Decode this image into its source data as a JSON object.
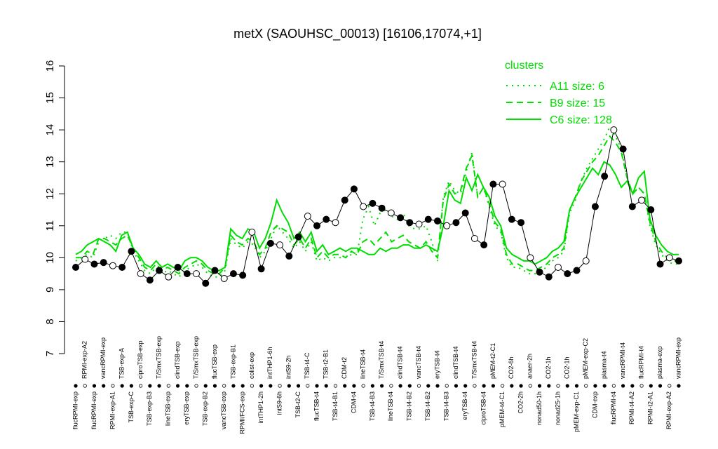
{
  "chart_data": {
    "type": "line",
    "title": "metX (SAOUHSC_00013) [16106,17074,+1]",
    "xlabel": "",
    "ylabel": "",
    "ylim": [
      7,
      16
    ],
    "yticks": [
      7,
      8,
      9,
      10,
      11,
      12,
      13,
      14,
      15,
      16
    ],
    "series": [
      {
        "name": "C6 size: 128",
        "style": "solid",
        "values": [
          10.1,
          10.2,
          10.4,
          10.5,
          10.6,
          10.5,
          10.4,
          10.2,
          10.7,
          10.8,
          10.3,
          10.1,
          9.8,
          9.7,
          9.9,
          9.7,
          9.8,
          9.7,
          9.6,
          9.9,
          10.0,
          10.0,
          9.9,
          9.7,
          9.6,
          9.6,
          9.7,
          10.9,
          10.7,
          10.6,
          10.9,
          10.8,
          10.3,
          10.6,
          11.1,
          11.8,
          11.4,
          11.1,
          10.6,
          10.8,
          10.5,
          10.8,
          10.2,
          10.4,
          10.1,
          10.2,
          10.3,
          10.2,
          10.3,
          10.3,
          10.2,
          10.1,
          10.1,
          10.3,
          10.2,
          10.3,
          10.3,
          10.4,
          10.4,
          10.3,
          10.3,
          10.4,
          10.3,
          10.2,
          11.0,
          12.1,
          11.8,
          11.7,
          12.5,
          12.1,
          12.6,
          12.2,
          11.9,
          11.3,
          11.0,
          10.3,
          10.1,
          10.0,
          9.9,
          9.9,
          9.8,
          9.9,
          10.0,
          10.2,
          10.3,
          10.5,
          11.5,
          11.9,
          12.2,
          12.5,
          12.8,
          12.6,
          13.0,
          12.9,
          12.6,
          12.2,
          12.4,
          12.0,
          12.5,
          12.7,
          11.2,
          10.7,
          10.4,
          10.2,
          10.1,
          10.1
        ]
      },
      {
        "name": "B9 size: 15",
        "style": "dashed",
        "values": [
          10.0,
          10.0,
          10.2,
          10.1,
          10.6,
          10.6,
          10.5,
          10.4,
          10.6,
          10.7,
          10.3,
          10.0,
          9.7,
          9.6,
          9.8,
          9.6,
          9.7,
          9.6,
          9.5,
          9.7,
          9.8,
          9.9,
          9.8,
          9.6,
          9.5,
          9.5,
          9.7,
          10.7,
          10.5,
          10.4,
          10.6,
          10.5,
          10.1,
          10.3,
          10.8,
          11.0,
          10.9,
          10.8,
          10.4,
          10.6,
          10.3,
          10.6,
          10.0,
          10.2,
          10.0,
          10.1,
          10.1,
          10.0,
          10.2,
          10.1,
          10.5,
          10.6,
          10.4,
          10.6,
          10.8,
          10.5,
          10.6,
          10.7,
          10.5,
          10.4,
          10.3,
          10.5,
          10.2,
          10.0,
          11.8,
          12.3,
          12.0,
          12.1,
          12.8,
          13.2,
          11.9,
          12.2,
          11.7,
          11.1,
          10.9,
          10.1,
          9.8,
          9.8,
          9.7,
          9.6,
          9.6,
          9.7,
          9.8,
          10.0,
          10.1,
          10.3,
          11.5,
          11.9,
          12.4,
          12.7,
          13.0,
          13.2,
          13.5,
          13.8,
          13.6,
          13.3,
          12.5,
          12.0,
          12.2,
          12.0,
          11.1,
          10.5,
          10.2,
          10.0,
          9.9,
          9.9
        ]
      },
      {
        "name": "A11 size: 6",
        "style": "dotted",
        "values": [
          9.9,
          10.0,
          10.1,
          10.0,
          10.5,
          10.6,
          10.7,
          10.6,
          10.8,
          10.8,
          10.2,
          9.9,
          9.6,
          9.5,
          9.7,
          9.5,
          9.6,
          9.5,
          9.4,
          9.6,
          9.7,
          9.8,
          9.7,
          9.5,
          9.4,
          9.4,
          9.6,
          10.6,
          10.4,
          10.3,
          10.5,
          10.4,
          10.0,
          10.2,
          10.6,
          11.0,
          10.8,
          10.6,
          10.3,
          10.5,
          10.2,
          10.5,
          9.9,
          10.0,
          9.9,
          10.0,
          10.0,
          10.0,
          10.1,
          10.1,
          11.2,
          11.6,
          11.0,
          11.4,
          11.5,
          11.3,
          11.2,
          11.4,
          11.0,
          10.9,
          10.9,
          11.0,
          10.5,
          9.9,
          11.9,
          12.4,
          12.1,
          12.0,
          12.7,
          13.3,
          11.9,
          12.2,
          11.6,
          11.0,
          10.8,
          10.0,
          9.7,
          9.7,
          9.6,
          9.5,
          9.5,
          9.6,
          9.7,
          9.9,
          10.0,
          10.2,
          11.4,
          11.8,
          12.4,
          12.8,
          13.1,
          13.4,
          13.7,
          14.1,
          13.8,
          13.4,
          12.5,
          12.0,
          12.2,
          12.0,
          11.0,
          10.4,
          10.1,
          9.9,
          9.8,
          9.8
        ]
      }
    ],
    "samples": {
      "labels": [
        "flucRPMI-exp",
        "RPMI-exp-A2",
        "flucRPMI-exp",
        "vancRPMI-exp",
        "RPMI-exp-A1",
        "TSB-exp-A",
        "TSB-exp-C",
        "ciproTSB-exp",
        "TSB-exp-B3",
        "T/SmxTSB-exp",
        "lineTSB-exp",
        "clindTSB-exp",
        "eryTSB-exp",
        "T/SmxTSB-exp",
        "TSB-exp-B2",
        "flucTSB-exp",
        "vancTSB-exp",
        "TSB-exp-B1",
        "RPMI/FCS-exp",
        "colist-exp",
        "intTHP1-2h",
        "intTHP1-6h",
        "intS9-6h",
        "intS9-2h",
        "TSB-t2-C",
        "TSB-t4-C",
        "flucTSB-t4",
        "TSB-t2-B1",
        "TSB-t4-B1",
        "CDM-t2",
        "CDM-t4",
        "lineTSB-t4",
        "TSB-t4-B3",
        "T/SmxTSB-t4",
        "lineTSB-t4",
        "clindTSB-t4",
        "TSB-t4-B2",
        "vancTSB-t4",
        "TSB-t4-B2",
        "eryTSB-t4",
        "TSB-t4-B3",
        "clindTSB-t4",
        "eryTSB-t4",
        "T/SmxTSB-t4",
        "ciproTSB-t4",
        "pMEM-t2-C1",
        "pMEM-t4-C1",
        "CO2-6h",
        "CO2-2h",
        "anaer-2h",
        "nonad50-1h",
        "CO2-1h",
        "nonad25-1h",
        "CO2-1h",
        "pMEM-exp-C1",
        "pMEM-exp-C2",
        "CDM-exp",
        "plasma-t4",
        "flucRPMI-t4",
        "vancRPMI-t4",
        "RPMI-t4-A2",
        "flucRPMI-t4",
        "RPMI-t2-A1",
        "plasma-exp",
        "RPMI-exp-A2",
        "vancRPMI-exp"
      ],
      "values": [
        9.7,
        9.95,
        9.8,
        9.85,
        9.75,
        9.7,
        10.2,
        9.5,
        9.3,
        9.6,
        9.4,
        9.7,
        9.5,
        9.5,
        9.2,
        9.6,
        9.35,
        9.5,
        9.45,
        10.8,
        9.65,
        10.45,
        10.4,
        10.05,
        10.65,
        11.3,
        11.0,
        11.2,
        11.1,
        11.8,
        12.15,
        11.6,
        11.7,
        11.55,
        11.4,
        11.25,
        11.1,
        11.05,
        11.2,
        11.15,
        11.0,
        11.1,
        11.4,
        10.6,
        10.4,
        12.3,
        12.3,
        11.2,
        11.1,
        10.0,
        9.55,
        9.4,
        9.7,
        9.5,
        9.6,
        9.9,
        11.6,
        12.55,
        14.0,
        13.4,
        11.6,
        11.8,
        11.5,
        9.8,
        10.0,
        9.9
      ]
    },
    "legend": {
      "title": "clusters",
      "placement": "top-right",
      "entries": [
        "A11 size: 6",
        "B9 size: 15",
        "C6 size: 128"
      ]
    },
    "grid": false,
    "colors": {
      "clusters": "#00dd00",
      "profile": "#000000"
    }
  }
}
